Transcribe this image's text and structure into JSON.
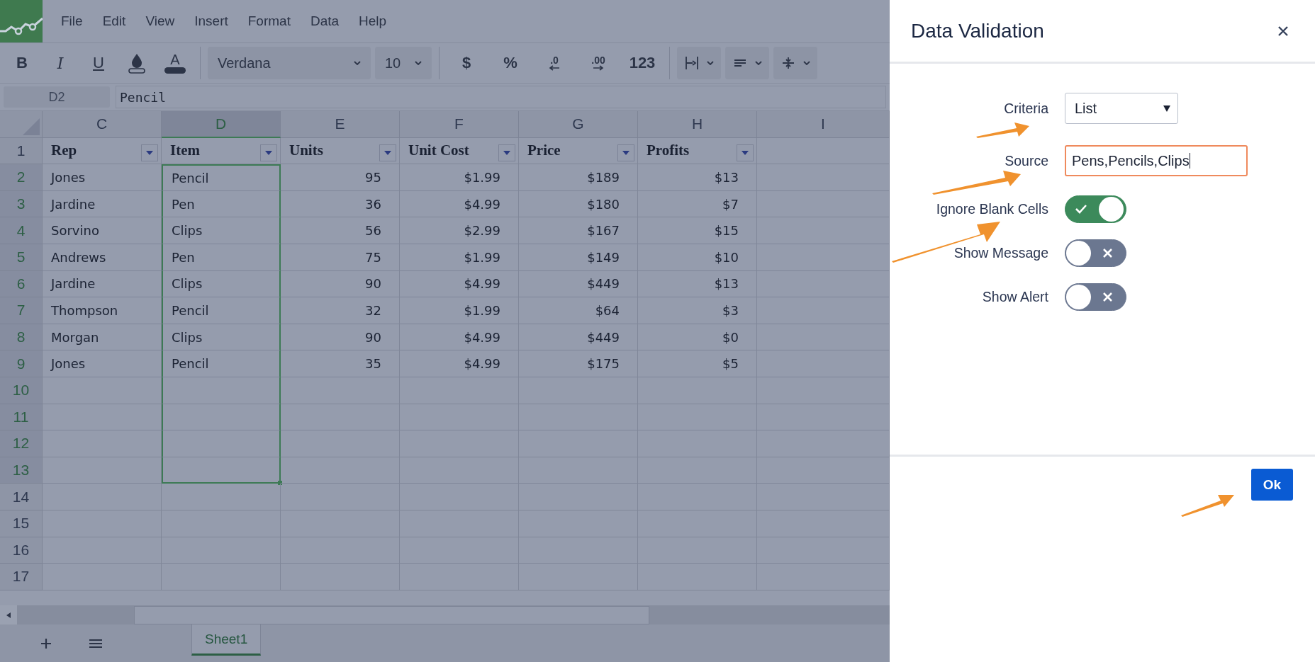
{
  "menu": [
    "File",
    "Edit",
    "View",
    "Insert",
    "Format",
    "Data",
    "Help"
  ],
  "toolbar": {
    "style_buttons": [
      {
        "kind": "bold",
        "label": "B"
      },
      {
        "kind": "italic",
        "label": "I"
      },
      {
        "kind": "underline",
        "label": "U"
      },
      {
        "kind": "fill"
      },
      {
        "kind": "text-color",
        "label": "A"
      }
    ],
    "font": "Verdana",
    "size": "10",
    "number_buttons": [
      {
        "kind": "text",
        "label": "$"
      },
      {
        "kind": "text",
        "label": "%"
      },
      {
        "kind": "decimal-less",
        "label": ".0"
      },
      {
        "kind": "decimal-more",
        "label": ".00"
      },
      {
        "kind": "text",
        "label": "123"
      }
    ],
    "dropdowns": [
      {
        "kind": "borders"
      },
      {
        "kind": "align"
      },
      {
        "kind": "valign"
      }
    ]
  },
  "formula_bar": {
    "cell": "D2",
    "value": "Pencil"
  },
  "sheet": {
    "columns": [
      {
        "label": "C",
        "selected": false,
        "kind": "text"
      },
      {
        "label": "D",
        "selected": true,
        "kind": "text"
      },
      {
        "label": "E",
        "selected": false,
        "kind": "number"
      },
      {
        "label": "F",
        "selected": false,
        "kind": "number"
      },
      {
        "label": "G",
        "selected": false,
        "kind": "number"
      },
      {
        "label": "H",
        "selected": false,
        "kind": "number"
      },
      {
        "label": "I",
        "selected": false,
        "kind": "text"
      }
    ],
    "header": {
      "number": "1",
      "cells": [
        {
          "text": "Rep",
          "filter": true
        },
        {
          "text": "Item",
          "filter": true
        },
        {
          "text": "Units",
          "filter": true
        },
        {
          "text": "Unit Cost",
          "filter": true
        },
        {
          "text": "Price",
          "filter": true
        },
        {
          "text": "Profits",
          "filter": true
        }
      ]
    },
    "rows": [
      {
        "number": "2",
        "selected": true,
        "cells": [
          "Jones",
          "Pencil",
          "95",
          "$1.99",
          "$189",
          "$13"
        ]
      },
      {
        "number": "3",
        "selected": true,
        "cells": [
          "Jardine",
          "Pen",
          "36",
          "$4.99",
          "$180",
          "$7"
        ]
      },
      {
        "number": "4",
        "selected": true,
        "cells": [
          "Sorvino",
          "Clips",
          "56",
          "$2.99",
          "$167",
          "$15"
        ]
      },
      {
        "number": "5",
        "selected": true,
        "cells": [
          "Andrews",
          "Pen",
          "75",
          "$1.99",
          "$149",
          "$10"
        ]
      },
      {
        "number": "6",
        "selected": true,
        "cells": [
          "Jardine",
          "Clips",
          "90",
          "$4.99",
          "$449",
          "$13"
        ]
      },
      {
        "number": "7",
        "selected": true,
        "cells": [
          "Thompson",
          "Pencil",
          "32",
          "$1.99",
          "$64",
          "$3"
        ]
      },
      {
        "number": "8",
        "selected": true,
        "cells": [
          "Morgan",
          "Clips",
          "90",
          "$4.99",
          "$449",
          "$0"
        ]
      },
      {
        "number": "9",
        "selected": true,
        "cells": [
          "Jones",
          "Pencil",
          "35",
          "$4.99",
          "$175",
          "$5"
        ]
      },
      {
        "number": "10",
        "selected": true,
        "cells": []
      },
      {
        "number": "11",
        "selected": true,
        "cells": []
      },
      {
        "number": "12",
        "selected": true,
        "cells": []
      },
      {
        "number": "13",
        "selected": true,
        "cells": []
      },
      {
        "number": "14",
        "selected": false,
        "cells": []
      },
      {
        "number": "15",
        "selected": false,
        "cells": []
      },
      {
        "number": "16",
        "selected": false,
        "cells": []
      },
      {
        "number": "17",
        "selected": false,
        "cells": []
      }
    ]
  },
  "sheet_tabs": [
    {
      "label": "Sheet1",
      "selected": true
    }
  ],
  "dialog": {
    "title": "Data Validation",
    "fields": [
      {
        "kind": "select",
        "label": "Criteria",
        "value": "List"
      },
      {
        "kind": "text",
        "label": "Source",
        "value": "Pens,Pencils,Clips",
        "focused": true
      },
      {
        "kind": "toggle",
        "label": "Ignore Blank Cells",
        "on": true
      },
      {
        "kind": "toggle",
        "label": "Show Message",
        "on": false
      },
      {
        "kind": "toggle",
        "label": "Show Alert",
        "on": false
      }
    ],
    "button": "Ok"
  }
}
